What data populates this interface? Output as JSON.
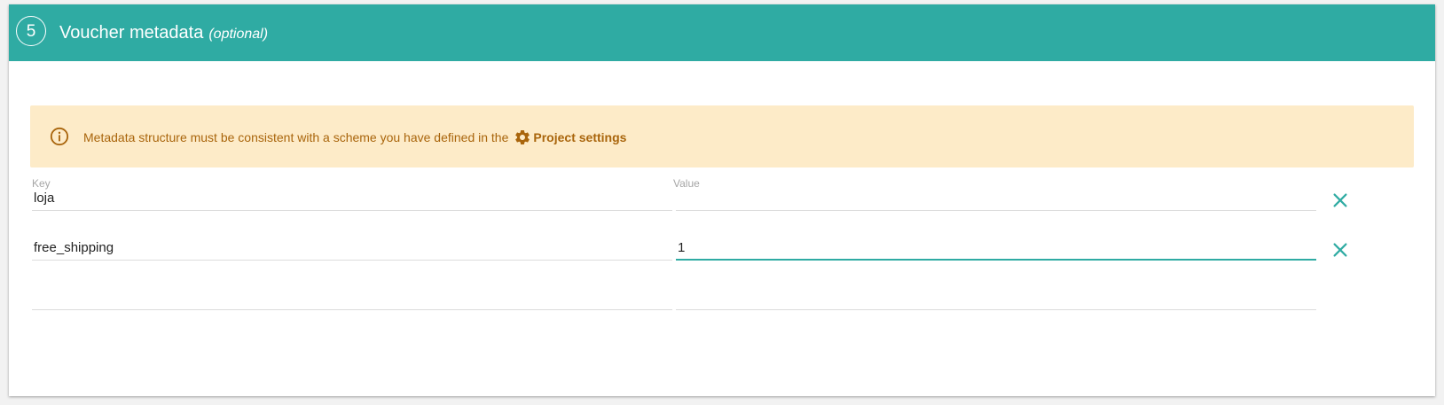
{
  "section": {
    "step_number": "5",
    "title": "Voucher metadata",
    "optional_label": "(optional)"
  },
  "colors": {
    "header_bg": "#2faba3",
    "alert_bg": "#fdebc8",
    "alert_text": "#a9650c",
    "accent": "#2faba3"
  },
  "alert": {
    "icon": "info-circle-icon",
    "message": "Metadata structure must be consistent with a scheme you have defined in the",
    "link_icon": "gear-icon",
    "link_label": "Project settings"
  },
  "metadata": {
    "key_label": "Key",
    "value_label": "Value",
    "remove_icon": "close-icon",
    "rows": [
      {
        "key": "loja",
        "value": ""
      },
      {
        "key": "free_shipping",
        "value": "1"
      },
      {
        "key": "",
        "value": ""
      }
    ]
  }
}
